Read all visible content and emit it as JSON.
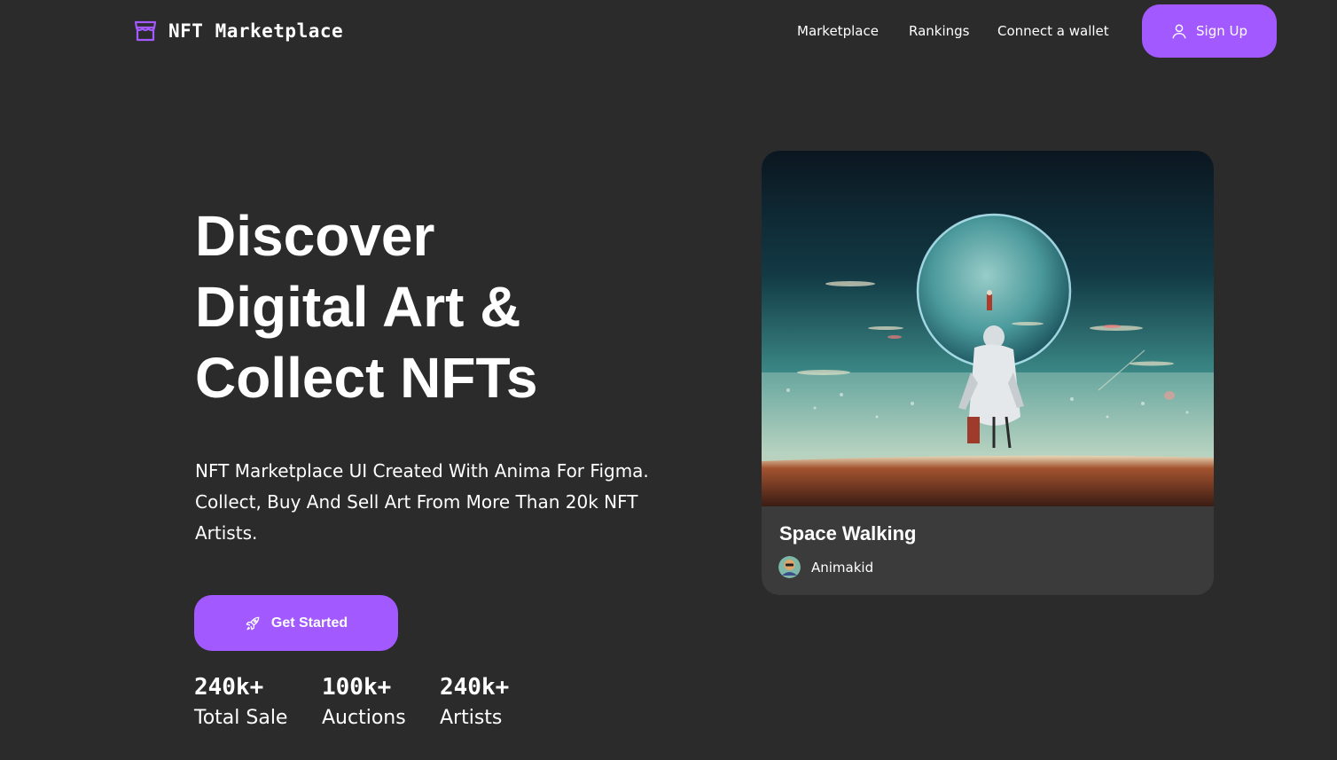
{
  "brand": {
    "name": "NFT Marketplace",
    "accent": "#a259ff",
    "background": "#2b2b2b",
    "card_background": "#3b3b3b",
    "icon": "storefront-icon"
  },
  "nav": {
    "links": [
      "Marketplace",
      "Rankings",
      "Connect a wallet"
    ],
    "signup_label": "Sign Up",
    "signup_icon": "user-icon"
  },
  "hero": {
    "title_lines": [
      "Discover",
      "Digital Art &",
      "Collect NFTs"
    ],
    "subtitle_lines": [
      "NFT Marketplace UI Created With Anima For Figma.",
      "Collect, Buy And Sell Art From More Than 20k NFT",
      "Artists."
    ],
    "cta_label": "Get Started",
    "cta_icon": "rocket-icon"
  },
  "stats": [
    {
      "value": "240k+",
      "label": "Total Sale"
    },
    {
      "value": "100k+",
      "label": "Auctions"
    },
    {
      "value": "240k+",
      "label": "Artists"
    }
  ],
  "featured": {
    "title": "Space Walking",
    "artist": "Animakid",
    "artwork": "astronaut-planet-artwork"
  }
}
